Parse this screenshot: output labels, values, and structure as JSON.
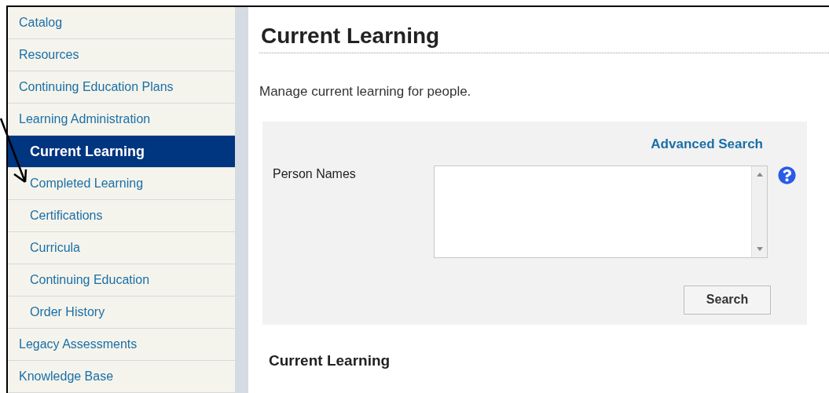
{
  "sidebar": {
    "items": [
      {
        "label": "Catalog",
        "selected": false
      },
      {
        "label": "Resources",
        "selected": false
      },
      {
        "label": "Continuing Education Plans",
        "selected": false
      },
      {
        "label": "Learning Administration",
        "selected": false,
        "children": [
          {
            "label": "Current Learning",
            "selected": true
          },
          {
            "label": "Completed Learning",
            "selected": false
          },
          {
            "label": "Certifications",
            "selected": false
          },
          {
            "label": "Curricula",
            "selected": false
          },
          {
            "label": "Continuing Education",
            "selected": false
          },
          {
            "label": "Order History",
            "selected": false
          }
        ]
      },
      {
        "label": "Legacy Assessments",
        "selected": false
      },
      {
        "label": "Knowledge Base",
        "selected": false
      }
    ]
  },
  "page": {
    "title": "Current Learning",
    "description": "Manage current learning for people.",
    "search_panel": {
      "advanced_link": "Advanced Search",
      "field_label": "Person Names",
      "button": "Search"
    },
    "section_heading": "Current Learning"
  }
}
